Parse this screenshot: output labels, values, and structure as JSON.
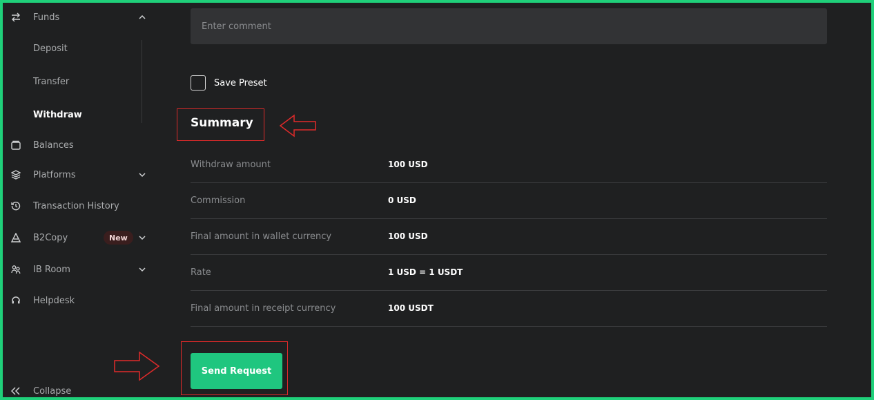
{
  "sidebar": {
    "funds": {
      "label": "Funds",
      "icon": "transfer-arrows-icon"
    },
    "sub_items": [
      "Deposit",
      "Transfer",
      "Withdraw"
    ],
    "items": [
      {
        "label": "Balances",
        "icon": "wallet-icon"
      },
      {
        "label": "Platforms",
        "icon": "layers-icon"
      },
      {
        "label": "Transaction History",
        "icon": "history-icon"
      },
      {
        "label": "B2Copy",
        "icon": "copy-trade-icon",
        "badge": "New"
      },
      {
        "label": "IB Room",
        "icon": "users-icon"
      },
      {
        "label": "Helpdesk",
        "icon": "headset-icon"
      }
    ],
    "collapse_label": "Collapse"
  },
  "form": {
    "comment_placeholder": "Enter comment",
    "save_preset_label": "Save Preset"
  },
  "summary": {
    "title": "Summary",
    "rows": [
      {
        "label": "Withdraw amount",
        "value": "100 USD"
      },
      {
        "label": "Commission",
        "value": "0 USD"
      },
      {
        "label": "Final amount in wallet currency",
        "value": "100 USD"
      },
      {
        "label": "Rate",
        "value": "1 USD = 1 USDT"
      },
      {
        "label": "Final amount in receipt currency",
        "value": "100 USDT"
      }
    ]
  },
  "actions": {
    "send_label": "Send Request"
  },
  "colors": {
    "accent": "#1fc67f",
    "frame": "#1fd07a",
    "annotation": "#e02a2a",
    "background": "#1f2021"
  }
}
